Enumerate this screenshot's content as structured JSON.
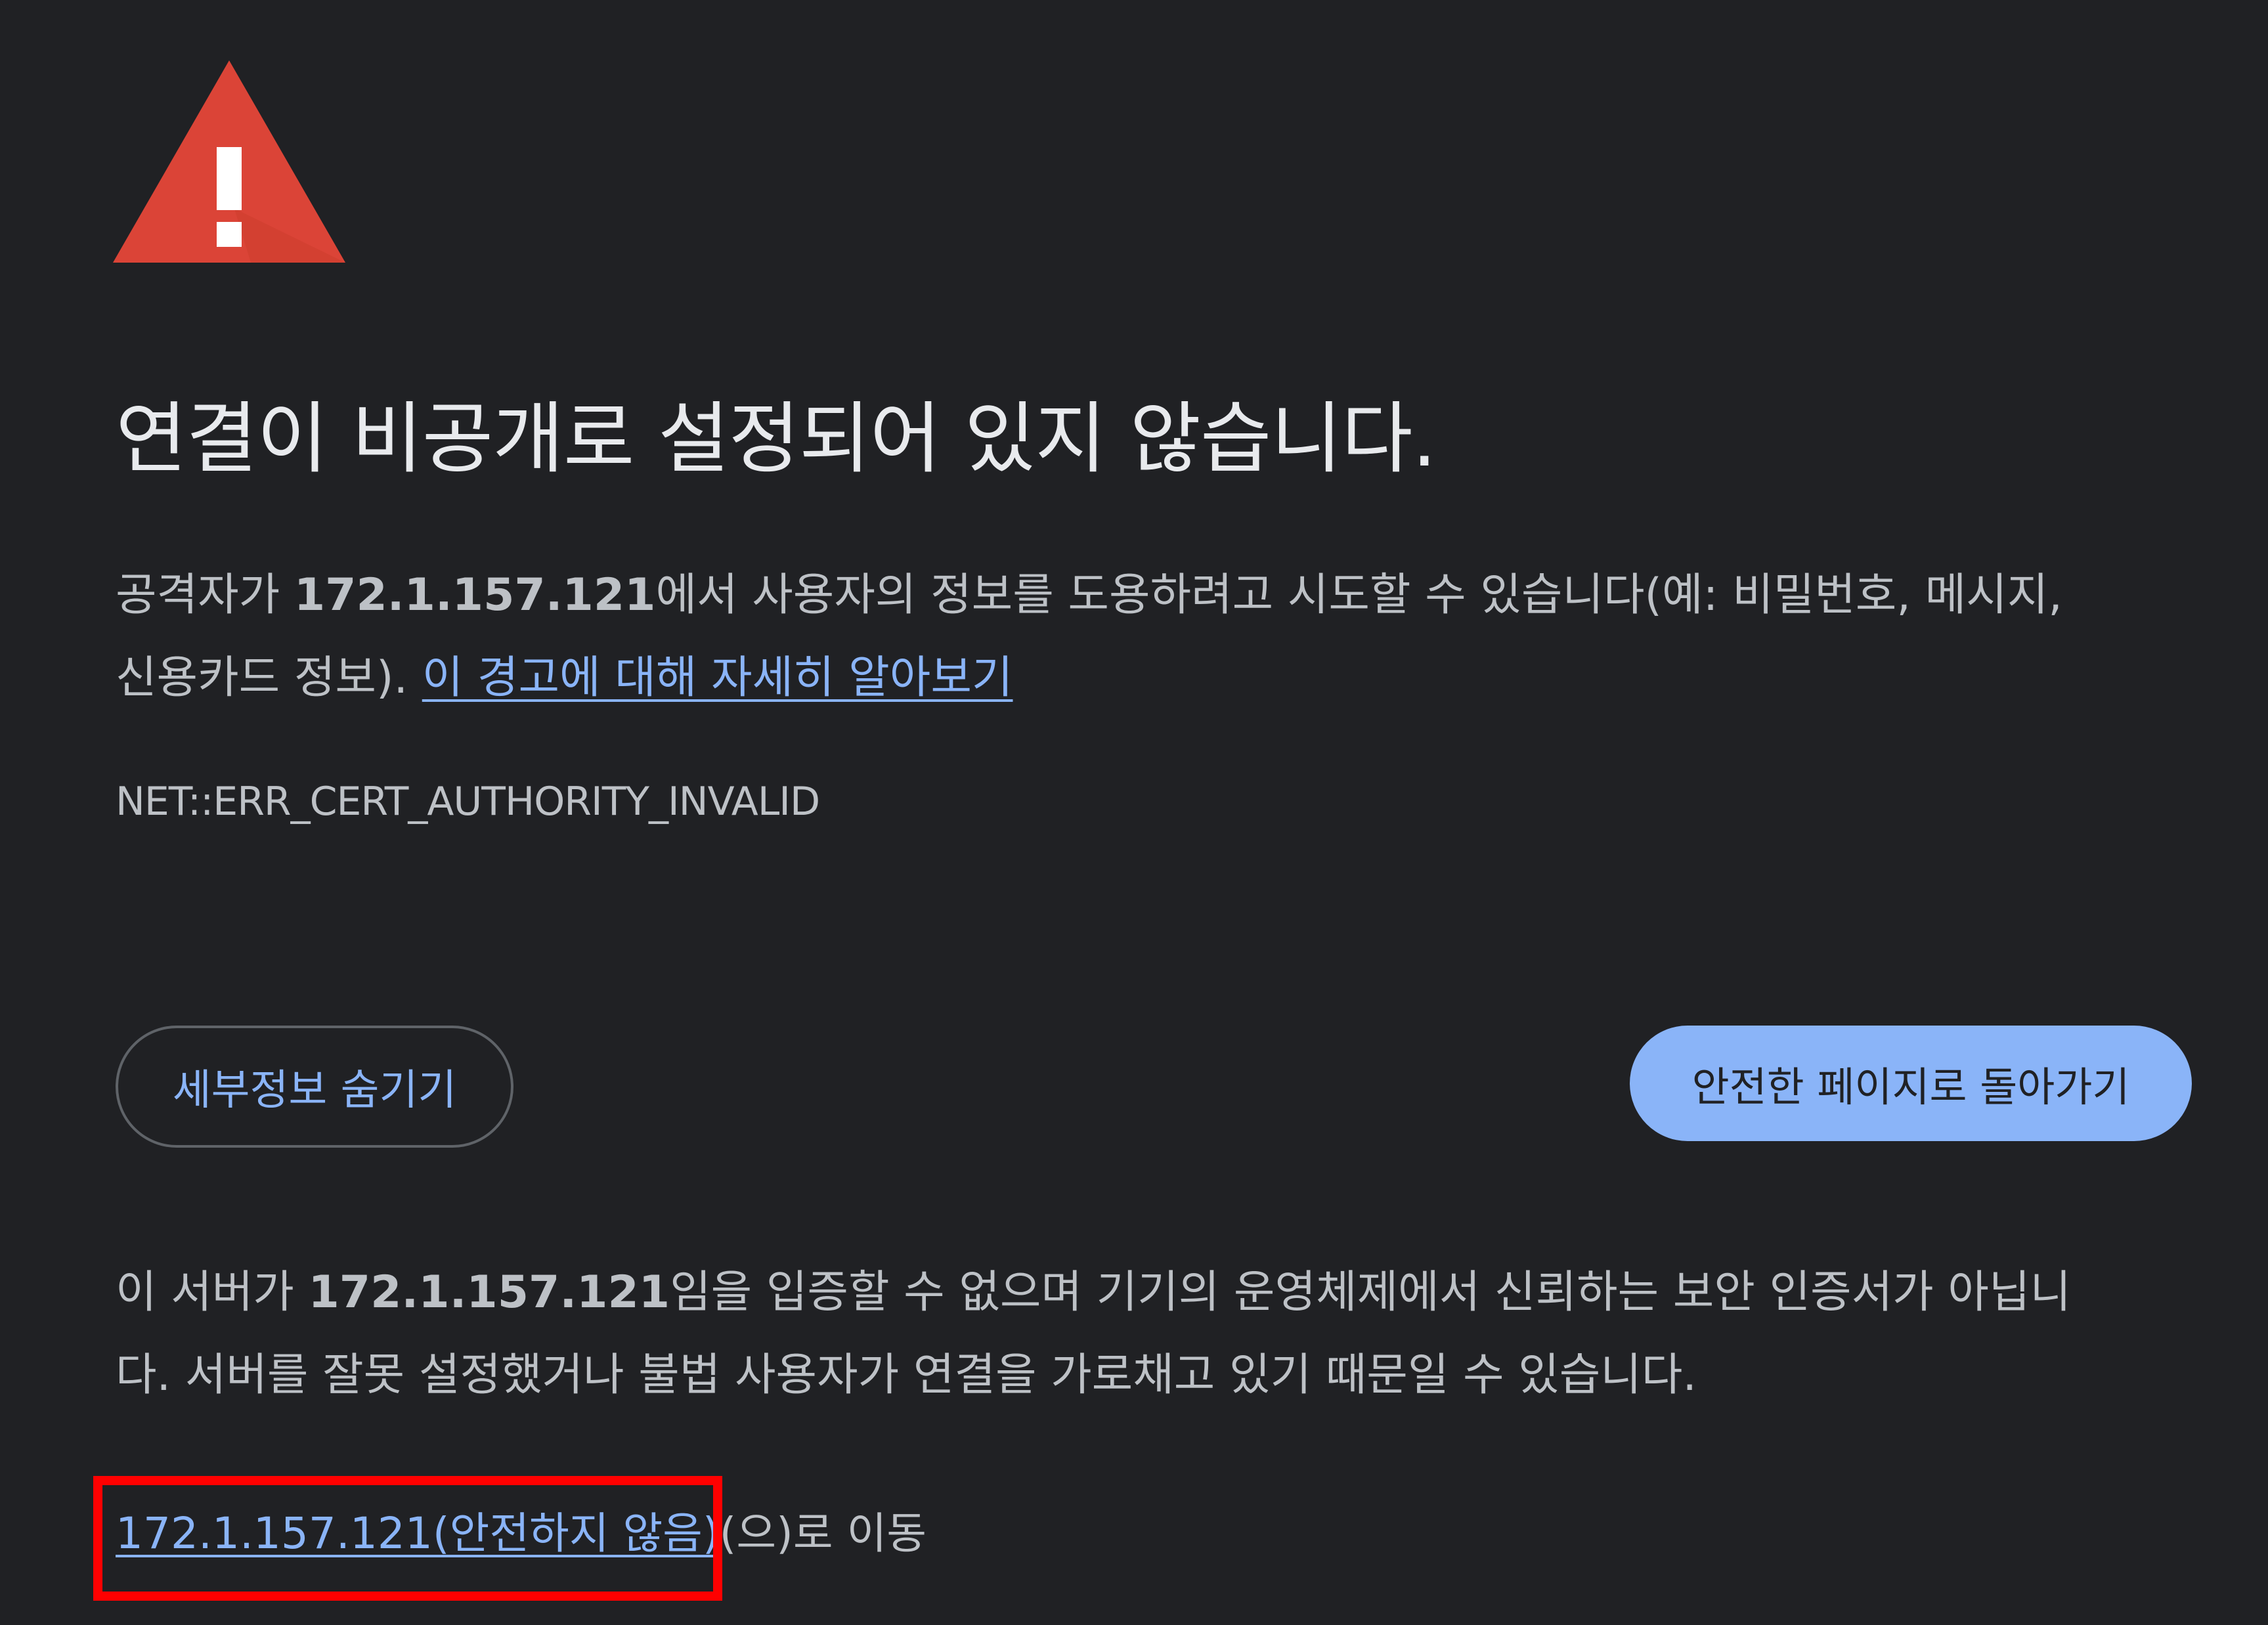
{
  "warning": {
    "icon": "warning-triangle-icon",
    "colors": {
      "triangle": "#db4437",
      "exclamation": "#ffffff"
    }
  },
  "heading": "연결이 비공개로 설정되어 있지 않습니다.",
  "description": {
    "prefix": "공격자가 ",
    "host": "172.1.157.121",
    "middle_line1": "에서 사용자의 정보를 도용하려고 시도할 수 있습니다(예: 비밀번호, 메시지,",
    "middle_line2": "신용카드 정보). ",
    "learn_more_link": "이 경고에 대해 자세히 알아보기"
  },
  "error_code": "NET::ERR_CERT_AUTHORITY_INVALID",
  "buttons": {
    "hide_details": "세부정보 숨기기",
    "back_to_safety": "안전한 페이지로 돌아가기"
  },
  "details": {
    "prefix": "이 서버가 ",
    "host": "172.1.157.121",
    "line1_rest": "임을 입증할 수 없으며 기기의 운영체제에서 신뢰하는 보안 인증서가 아닙니",
    "line2": "다. 서버를 잘못 설정했거나 불법 사용자가 연결을 가로채고 있기 때문일 수 있습니다."
  },
  "proceed": {
    "link": "172.1.157.121(안전하지 않음)",
    "suffix": "(으)로 이동"
  },
  "colors": {
    "background": "#202124",
    "heading_text": "#e8eaed",
    "body_text": "#bdc1c6",
    "link": "#8ab4f8",
    "primary_button_bg": "#8ab4f8",
    "primary_button_text": "#202124",
    "secondary_button_border": "#5f6368",
    "highlight_box": "#ff0000"
  }
}
